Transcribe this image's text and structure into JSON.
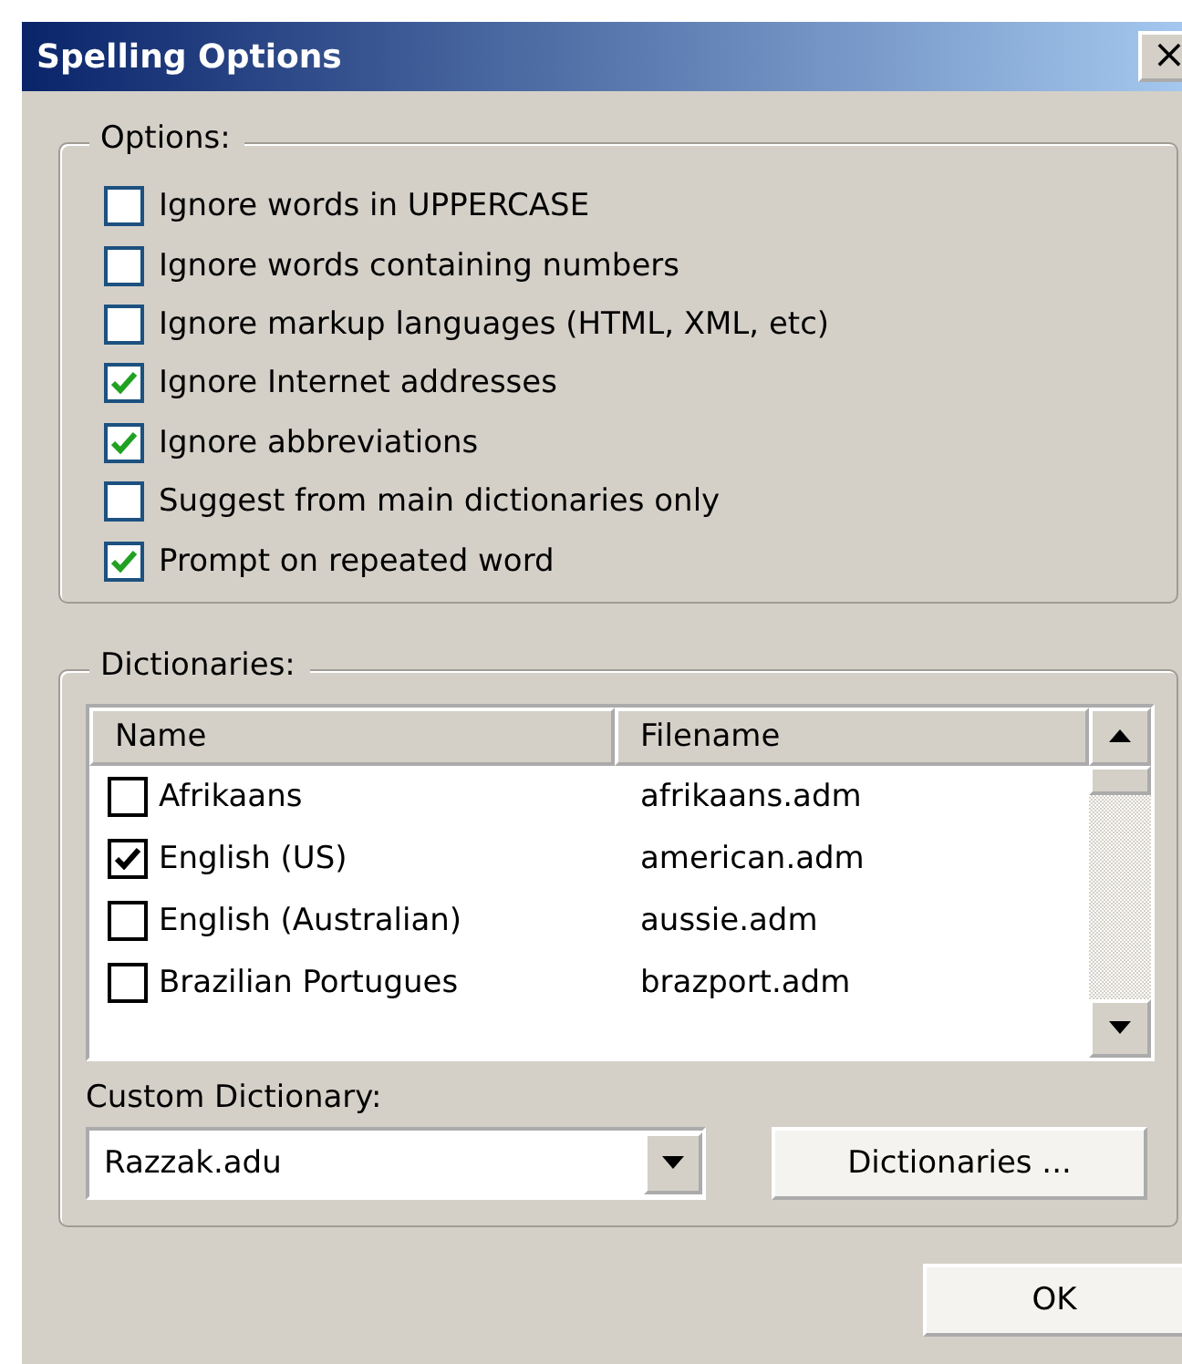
{
  "window": {
    "title": "Spelling Options",
    "close": "×"
  },
  "options": {
    "label": "Options:",
    "items": [
      {
        "label": "Ignore words in UPPERCASE",
        "checked": false
      },
      {
        "label": "Ignore words containing numbers",
        "checked": false
      },
      {
        "label": "Ignore markup languages (HTML, XML, etc)",
        "checked": false
      },
      {
        "label": "Ignore Internet addresses",
        "checked": true
      },
      {
        "label": "Ignore abbreviations",
        "checked": true
      },
      {
        "label": "Suggest from main dictionaries only",
        "checked": false
      },
      {
        "label": "Prompt on repeated word",
        "checked": true
      }
    ]
  },
  "dictionaries": {
    "label": "Dictionaries:",
    "columns": [
      "Name",
      "Filename"
    ],
    "rows": [
      {
        "name": "Afrikaans",
        "filename": "afrikaans.adm",
        "checked": false
      },
      {
        "name": "English (US)",
        "filename": "american.adm",
        "checked": true
      },
      {
        "name": "English (Australian)",
        "filename": "aussie.adm",
        "checked": false
      },
      {
        "name": "Brazilian Portugues",
        "filename": "brazport.adm",
        "checked": false
      }
    ],
    "custom_label": "Custom Dictionary:",
    "custom_value": "Razzak.adu",
    "dictionaries_button": "Dictionaries ..."
  },
  "buttons": [
    "OK"
  ]
}
